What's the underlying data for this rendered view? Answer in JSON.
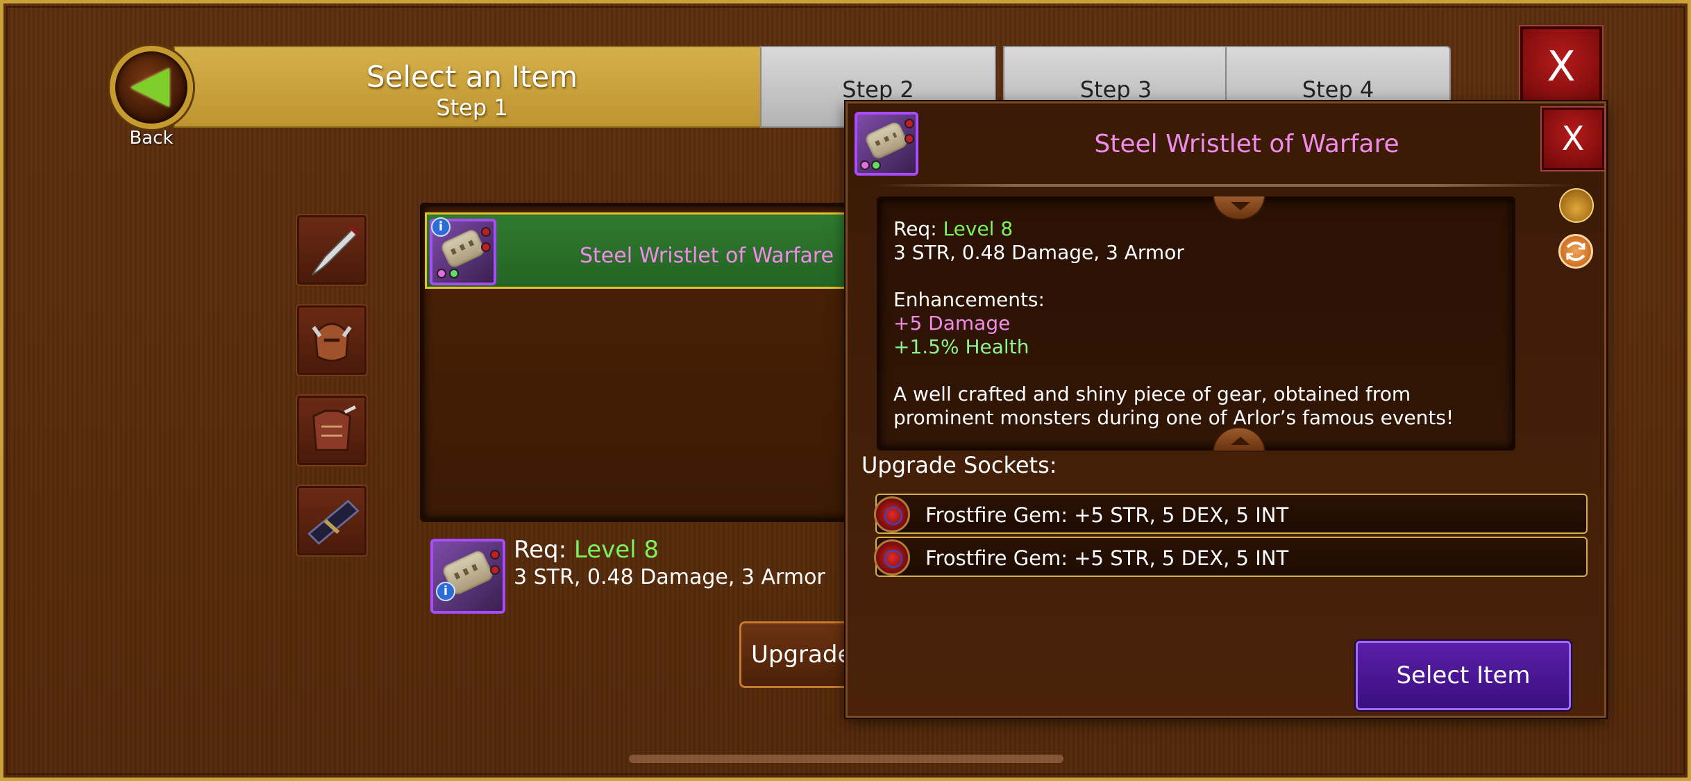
{
  "nav": {
    "back_label": "Back"
  },
  "steps": [
    {
      "title": "Select an Item",
      "subtitle": "Step 1",
      "active": true
    },
    {
      "title": "Step 2",
      "active": false
    },
    {
      "title": "Step 3",
      "active": false
    },
    {
      "title": "Step 4",
      "active": false
    }
  ],
  "close_label": "X",
  "categories": [
    {
      "icon": "dagger-icon"
    },
    {
      "icon": "helmet-icon"
    },
    {
      "icon": "chest-armor-icon"
    },
    {
      "icon": "bracer-icon"
    }
  ],
  "item_list": [
    {
      "name": "Steel Wristlet of Warfare",
      "selected": true
    }
  ],
  "selected_item": {
    "req_label": "Req:",
    "req_level": "Level 8",
    "stats": "3 STR, 0.48 Damage, 3 Armor"
  },
  "upgrade_button": "Upgrade",
  "popup": {
    "title": "Steel Wristlet of Warfare",
    "close": "X",
    "req_label": "Req:",
    "req_level": "Level 8",
    "stats": "3 STR, 0.48 Damage, 3 Armor",
    "enhancements_label": "Enhancements:",
    "enhancements": [
      "+5 Damage",
      "+1.5% Health"
    ],
    "description_line1": "A well crafted and shiny piece of gear, obtained from",
    "description_line2": "prominent monsters during one of Arlor’s famous events!",
    "sockets_label": "Upgrade Sockets:",
    "sockets": [
      "Frostfire Gem: +5 STR, 5 DEX, 5 INT",
      "Frostfire Gem: +5 STR, 5 DEX, 5 INT"
    ],
    "select_button": "Select Item"
  },
  "colors": {
    "item_name": "#f18be8",
    "level_green": "#7cf25a",
    "select_purple": "#4a1594"
  }
}
